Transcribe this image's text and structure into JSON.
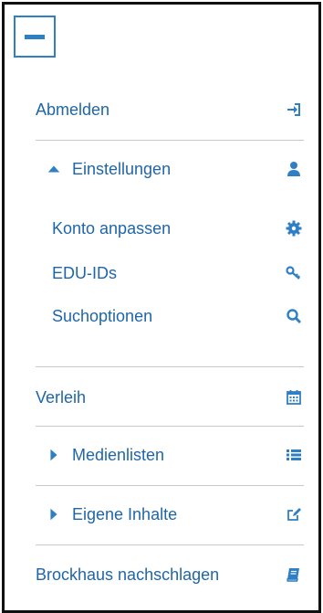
{
  "accent_color": "#2f7fc4",
  "text_color": "#1f66a8",
  "menu": {
    "toggle_icon": "minus-icon",
    "logout": {
      "label": "Abmelden",
      "icon": "sign-in-icon"
    },
    "settings": {
      "label": "Einstellungen",
      "icon": "user-icon",
      "expanded": true,
      "items": [
        {
          "label": "Konto anpassen",
          "icon": "gear-icon"
        },
        {
          "label": "EDU-IDs",
          "icon": "key-icon"
        },
        {
          "label": "Suchoptionen",
          "icon": "search-icon"
        }
      ]
    },
    "loans": {
      "label": "Verleih",
      "icon": "calendar-icon"
    },
    "media_lists": {
      "label": "Medienlisten",
      "icon": "list-icon",
      "expanded": false
    },
    "own_content": {
      "label": "Eigene Inhalte",
      "icon": "edit-icon",
      "expanded": false
    },
    "brockhaus": {
      "label": "Brockhaus nachschlagen",
      "icon": "book-icon"
    }
  }
}
